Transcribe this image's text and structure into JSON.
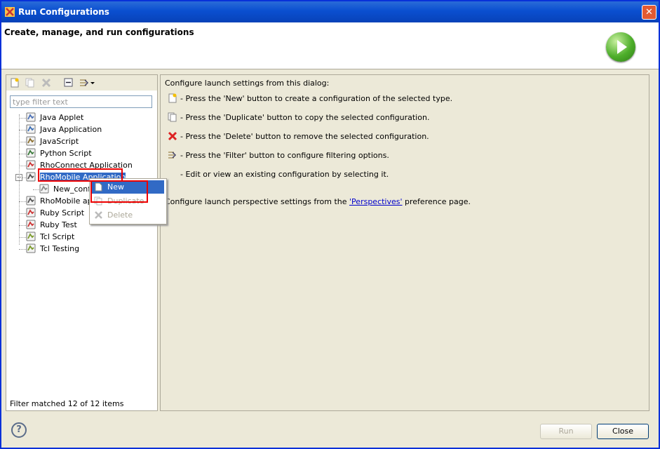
{
  "window": {
    "title": "Run Configurations",
    "close_glyph": "✕"
  },
  "header": {
    "title": "Create, manage, and run configurations"
  },
  "left": {
    "filter_placeholder": "type filter text",
    "tree": [
      {
        "label": "Java Applet",
        "icon": "java-applet-icon"
      },
      {
        "label": "Java Application",
        "icon": "java-application-icon"
      },
      {
        "label": "JavaScript",
        "icon": "javascript-icon"
      },
      {
        "label": "Python Script",
        "icon": "python-script-icon"
      },
      {
        "label": "RhoConnect Application",
        "icon": "rhoconnect-icon"
      },
      {
        "label": "RhoMobile Application",
        "icon": "rhomobile-icon",
        "selected": true,
        "expanded": true
      },
      {
        "label": "New_confi",
        "icon": "config-icon",
        "child": true
      },
      {
        "label": "RhoMobile app",
        "icon": "rhomobile-app-icon"
      },
      {
        "label": "Ruby Script",
        "icon": "ruby-script-icon"
      },
      {
        "label": "Ruby Test",
        "icon": "ruby-test-icon"
      },
      {
        "label": "Tcl Script",
        "icon": "tcl-script-icon"
      },
      {
        "label": "Tcl Testing",
        "icon": "tcl-testing-icon"
      }
    ],
    "status": "Filter matched 12 of 12 items"
  },
  "right": {
    "intro": "Configure launch settings from this dialog:",
    "lines": [
      "- Press the 'New' button to create a configuration of the selected type.",
      "- Press the 'Duplicate' button to copy the selected configuration.",
      "- Press the 'Delete' button to remove the selected configuration.",
      "- Press the 'Filter' button to configure filtering options.",
      "- Edit or view an existing configuration by selecting it."
    ],
    "perspective_prefix": "Configure launch perspective settings from the ",
    "perspective_link": "'Perspectives'",
    "perspective_suffix": " preference page."
  },
  "context_menu": {
    "new": "New",
    "duplicate": "Duplicate",
    "delete": "Delete"
  },
  "footer": {
    "help": "?",
    "run": "Run",
    "close": "Close"
  }
}
